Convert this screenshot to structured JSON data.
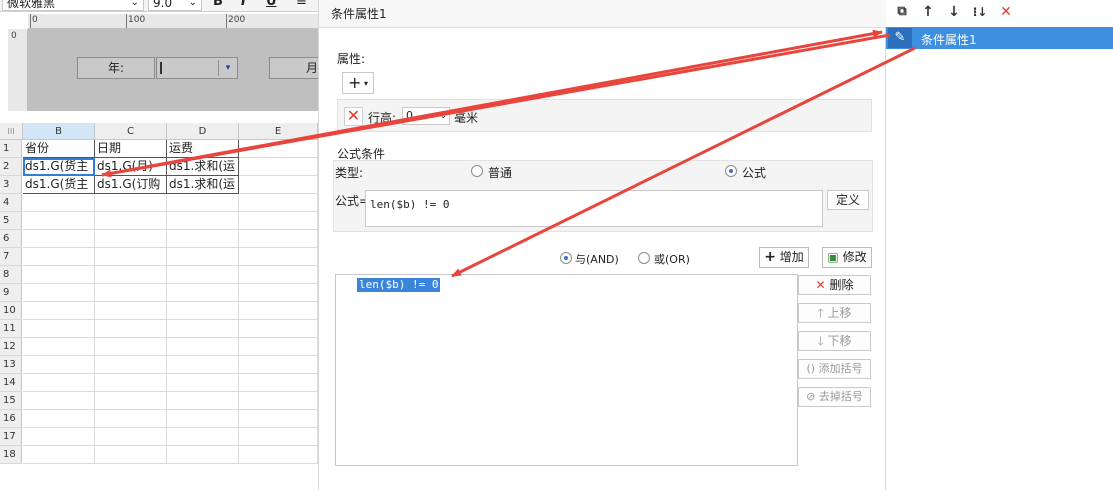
{
  "toolbar": {
    "font_name": "微软雅黑",
    "font_size": "9.0",
    "bold": "B",
    "italic": "I",
    "underline": "U"
  },
  "ruler": {
    "h_marks": [
      "0",
      "100",
      "200"
    ],
    "v_mark": "0"
  },
  "parameters": {
    "year_label": "年:",
    "month_label": "月:"
  },
  "sheet": {
    "columns": [
      "B",
      "C",
      "D",
      "E"
    ],
    "rows": [
      "1",
      "2",
      "3",
      "4",
      "5",
      "6",
      "7",
      "8",
      "9",
      "10",
      "11",
      "12",
      "13",
      "14",
      "15",
      "16",
      "17",
      "18"
    ],
    "cells": {
      "r1": [
        "省份",
        "日期",
        "运费"
      ],
      "r2": [
        "ds1.G(货主",
        "ds1.G(月)",
        "ds1.求和(运"
      ],
      "r3": [
        "ds1.G(货主",
        "ds1.G(订购",
        "ds1.求和(运"
      ]
    }
  },
  "dialog": {
    "title": "条件属性1",
    "attributes": {
      "section_label": "属性:",
      "add_symbol": "+",
      "row_height_label": "行高:",
      "row_height_value": "0",
      "unit": "毫米"
    },
    "formula_condition": {
      "section_label": "公式条件",
      "type_label": "类型:",
      "type_normal": "普通",
      "type_formula": "公式",
      "selected_type": "公式",
      "formula_label": "公式=",
      "formula_value": "len($b) != 0",
      "define_button": "定义"
    },
    "logic": {
      "and_label": "与(AND)",
      "or_label": "或(OR)",
      "selected": "与(AND)",
      "add_button": "增加",
      "modify_button": "修改"
    },
    "condition_list": [
      "len($b) != 0"
    ],
    "side_buttons": {
      "delete": "删除",
      "move_up": "上移",
      "move_down": "下移",
      "add_bracket": "添加括号",
      "remove_bracket": "去掉括号"
    }
  },
  "right_panel": {
    "items": [
      "条件属性1"
    ]
  },
  "colors": {
    "accent_blue": "#3d8fdf",
    "selection_highlight": "#2f7fd8",
    "arrow_red": "#e8453c",
    "delete_red": "#e03b30"
  }
}
